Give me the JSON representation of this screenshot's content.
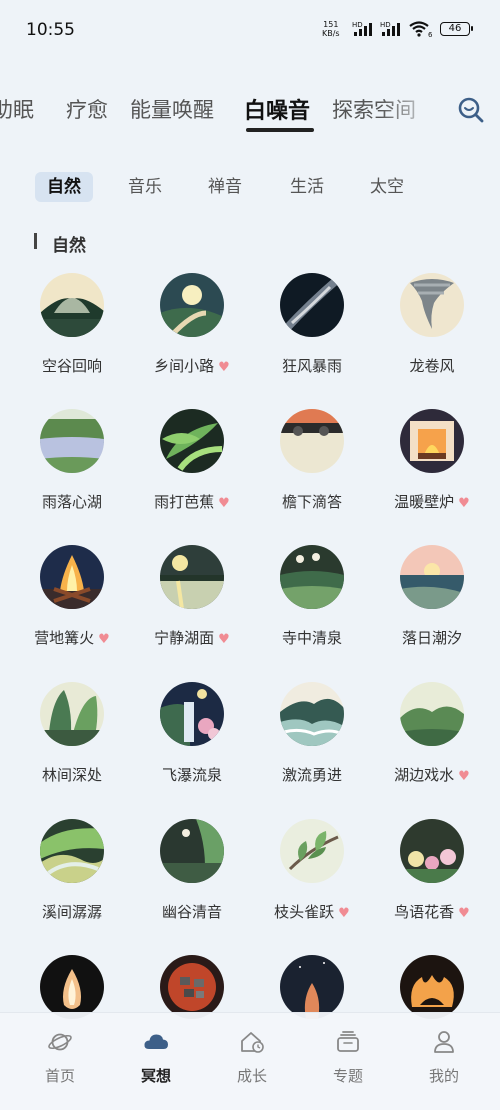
{
  "status_bar": {
    "time": "10:55",
    "net_speed": "151",
    "net_unit": "KB/s",
    "sim1": "HD",
    "sim2": "HD",
    "wifi_sub": "6",
    "battery": "46"
  },
  "top_tabs": [
    "助眠",
    "疗愈",
    "能量唤醒",
    "白噪音",
    "探索空间"
  ],
  "top_tab_active": "白噪音",
  "sub_tabs": [
    "自然",
    "音乐",
    "禅音",
    "生活",
    "太空"
  ],
  "sub_tab_active": "自然",
  "section": {
    "title": "自然"
  },
  "items": [
    {
      "name": "空谷回响",
      "fav": false,
      "icon": "canyon-thumb"
    },
    {
      "name": "乡间小路",
      "fav": true,
      "icon": "country-road-thumb"
    },
    {
      "name": "狂风暴雨",
      "fav": false,
      "icon": "storm-thumb"
    },
    {
      "name": "龙卷风",
      "fav": false,
      "icon": "tornado-thumb"
    },
    {
      "name": "雨落心湖",
      "fav": false,
      "icon": "lake-rain-thumb"
    },
    {
      "name": "雨打芭蕉",
      "fav": true,
      "icon": "banana-leaf-thumb"
    },
    {
      "name": "檐下滴答",
      "fav": false,
      "icon": "eaves-thumb"
    },
    {
      "name": "温暖壁炉",
      "fav": true,
      "icon": "fireplace-thumb"
    },
    {
      "name": "营地篝火",
      "fav": true,
      "icon": "campfire-thumb"
    },
    {
      "name": "宁静湖面",
      "fav": true,
      "icon": "calm-lake-thumb"
    },
    {
      "name": "寺中清泉",
      "fav": false,
      "icon": "temple-spring-thumb"
    },
    {
      "name": "落日潮汐",
      "fav": false,
      "icon": "sunset-tide-thumb"
    },
    {
      "name": "林间深处",
      "fav": false,
      "icon": "deep-forest-thumb"
    },
    {
      "name": "飞瀑流泉",
      "fav": false,
      "icon": "waterfall-thumb"
    },
    {
      "name": "激流勇进",
      "fav": false,
      "icon": "rapids-thumb"
    },
    {
      "name": "湖边戏水",
      "fav": true,
      "icon": "lakeside-thumb"
    },
    {
      "name": "溪间潺潺",
      "fav": false,
      "icon": "creek-thumb"
    },
    {
      "name": "幽谷清音",
      "fav": false,
      "icon": "valley-thumb"
    },
    {
      "name": "枝头雀跃",
      "fav": true,
      "icon": "branch-bird-thumb"
    },
    {
      "name": "鸟语花香",
      "fav": true,
      "icon": "flowers-thumb"
    },
    {
      "name": "",
      "fav": false,
      "icon": "candle-thumb"
    },
    {
      "name": "",
      "fav": false,
      "icon": "coals-thumb"
    },
    {
      "name": "",
      "fav": false,
      "icon": "night-fire-thumb"
    },
    {
      "name": "",
      "fav": false,
      "icon": "fire-ring-thumb"
    }
  ],
  "heart_glyph": "♥",
  "bottom_nav": [
    {
      "label": "首页",
      "icon": "planet-icon",
      "active": false
    },
    {
      "label": "冥想",
      "icon": "cloud-icon",
      "active": true
    },
    {
      "label": "成长",
      "icon": "house-clock-icon",
      "active": false
    },
    {
      "label": "专题",
      "icon": "stack-icon",
      "active": false
    },
    {
      "label": "我的",
      "icon": "person-icon",
      "active": false
    }
  ],
  "colors": {
    "background": "#eef3f8",
    "accent": "#3d5f88",
    "heart": "#f08b93",
    "sub_tab_active_bg": "#d7e3f1"
  }
}
